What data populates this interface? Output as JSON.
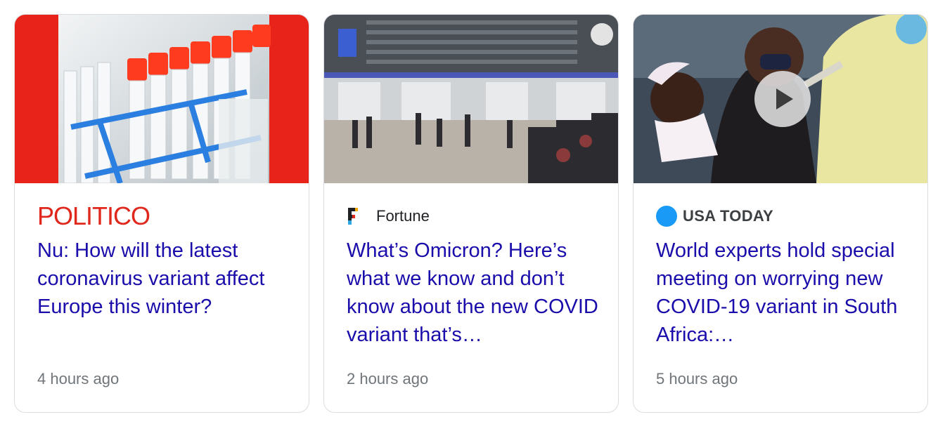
{
  "cards": [
    {
      "source": "POLITICO",
      "headline": "Nu: How will the latest coronavirus variant affect Europe this winter?",
      "time": "4 hours ago",
      "image_icon": "test-tubes-image"
    },
    {
      "source": "Fortune",
      "headline": "What’s Omicron? Here’s what we know and don’t know about the new COVID variant that’s…",
      "time": "2 hours ago",
      "image_icon": "airport-terminal-image"
    },
    {
      "source": "USA TODAY",
      "headline": "World experts hold special meeting on worrying new COVID-19 variant in South Africa:…",
      "time": "5 hours ago",
      "image_icon": "vaccination-video-thumbnail",
      "has_video": true
    }
  ],
  "colors": {
    "headline_link": "#1a0dab",
    "politico_red": "#e0271c",
    "usa_today_blue": "#1a9af7",
    "timestamp": "#70757a"
  }
}
